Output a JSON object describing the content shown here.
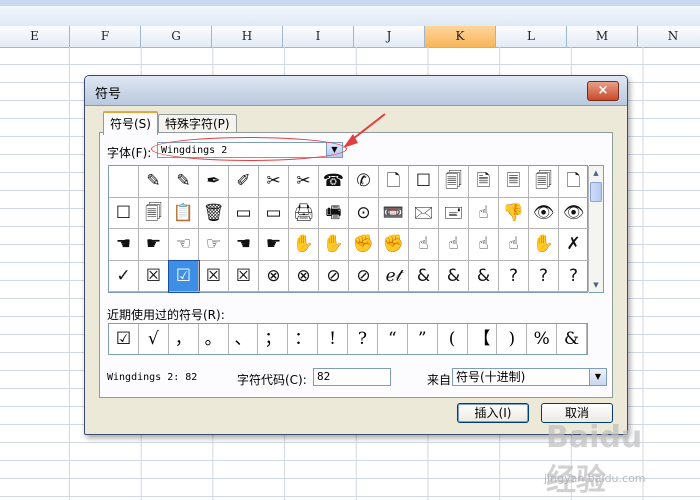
{
  "spreadsheet": {
    "columns": [
      "E",
      "F",
      "G",
      "H",
      "I",
      "J",
      "K",
      "L",
      "M",
      "N"
    ],
    "active_column": "K"
  },
  "dialog": {
    "title": "符号",
    "close_label": "×",
    "tabs": [
      {
        "label": "符号(S)",
        "active": true
      },
      {
        "label": "特殊字符(P)",
        "active": false
      }
    ],
    "font": {
      "label": "字体(F):",
      "value": "Wingdings 2"
    },
    "symbols": [
      "",
      "✎",
      "✎",
      "✒",
      "✐",
      "✂",
      "✂",
      "☎",
      "✆",
      "🗋",
      "☐",
      "🗐",
      "🗎",
      "🗏",
      "🗐",
      "🗋",
      "☐",
      "🗐",
      "📋",
      "🗑",
      "▭",
      "▭",
      "🖨",
      "🖷",
      "⊙",
      "📼",
      "🖂",
      "🖃",
      "☝",
      "👎",
      "👁",
      "👁",
      "☚",
      "☛",
      "☜",
      "☞",
      "☚",
      "☛",
      "✋",
      "✋",
      "✊",
      "✊",
      "☝",
      "☝",
      "☝",
      "☝",
      "✋",
      "✗",
      "✓",
      "☒",
      "☑",
      "☒",
      "☒",
      "⊗",
      "⊗",
      "⊘",
      "⊘",
      "ℯ𝓉",
      "&",
      "&",
      "&",
      "?",
      "?",
      "?"
    ],
    "selected_index": 50,
    "recent_label": "近期使用过的符号(R):",
    "recent_symbols": [
      "☑",
      "√",
      "，",
      "。",
      "、",
      "；",
      "：",
      "!",
      "?",
      "“",
      "”",
      "(",
      "【",
      ")",
      "%",
      "&"
    ],
    "code_name": "Wingdings 2: 82",
    "char_code": {
      "label": "字符代码(C):",
      "value": "82"
    },
    "from": {
      "label": "来自(M):",
      "value": "符号(十进制)"
    },
    "insert_label": "插入(I)",
    "cancel_label": "取消"
  },
  "annotation_color": "#e04040",
  "watermark": {
    "logo": "Baidu 经验",
    "url": "jingyan.baidu.com"
  }
}
